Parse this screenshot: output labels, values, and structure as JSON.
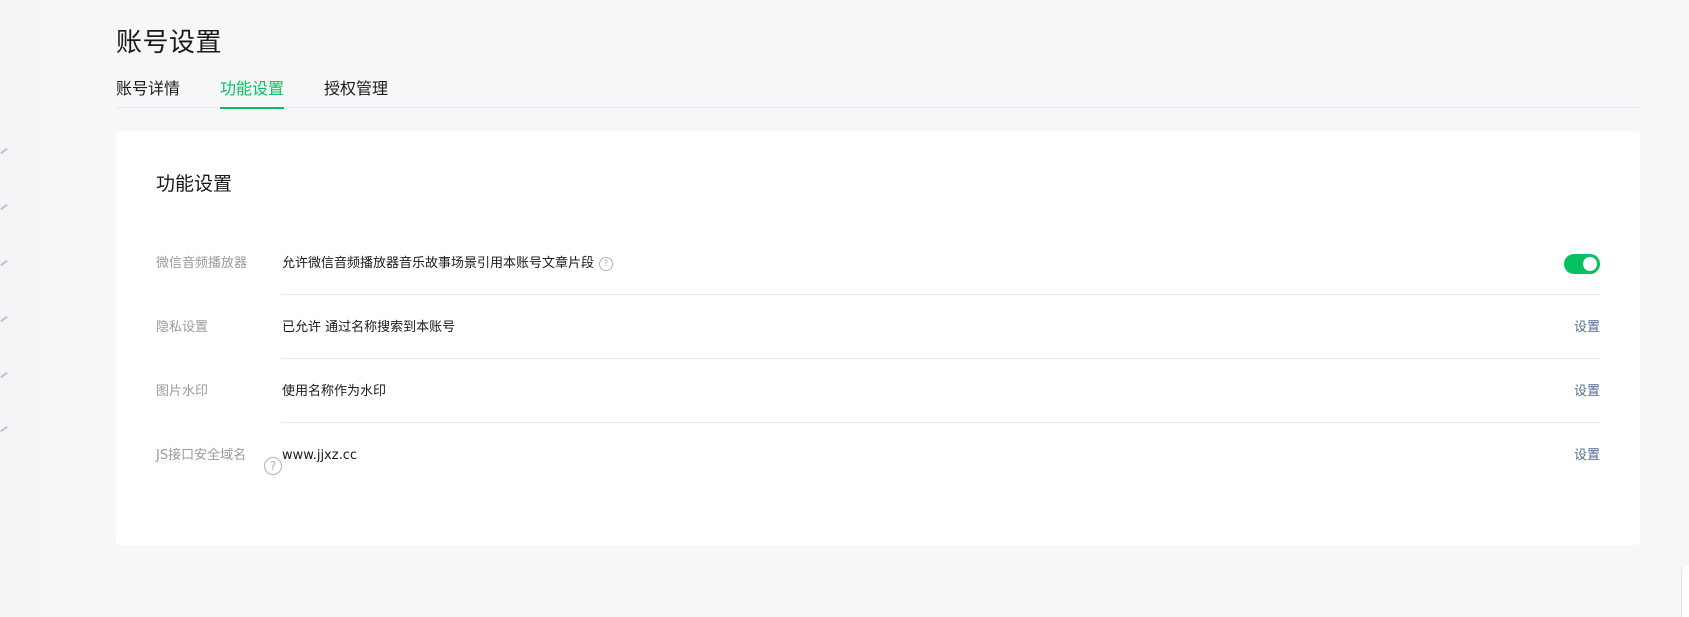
{
  "page": {
    "title": "账号设置"
  },
  "tabs": [
    {
      "label": "账号详情",
      "active": false
    },
    {
      "label": "功能设置",
      "active": true
    },
    {
      "label": "授权管理",
      "active": false
    }
  ],
  "card": {
    "title": "功能设置",
    "rows": [
      {
        "label": "微信音频播放器",
        "value": "允许微信音频播放器音乐故事场景引用本账号文章片段",
        "control": "toggle",
        "enabled": true
      },
      {
        "label": "隐私设置",
        "value": "已允许 通过名称搜索到本账号",
        "action": "设置"
      },
      {
        "label": "图片水印",
        "value": "使用名称作为水印",
        "action": "设置"
      },
      {
        "label": "JS接口安全域名",
        "value": "www.jjxz.cc",
        "action": "设置"
      }
    ]
  },
  "colors": {
    "accent": "#07c160",
    "link": "#576b95",
    "label": "#9a9a9a",
    "background": "#f6f7f9"
  },
  "icons": {
    "help": "question-circle-icon"
  }
}
